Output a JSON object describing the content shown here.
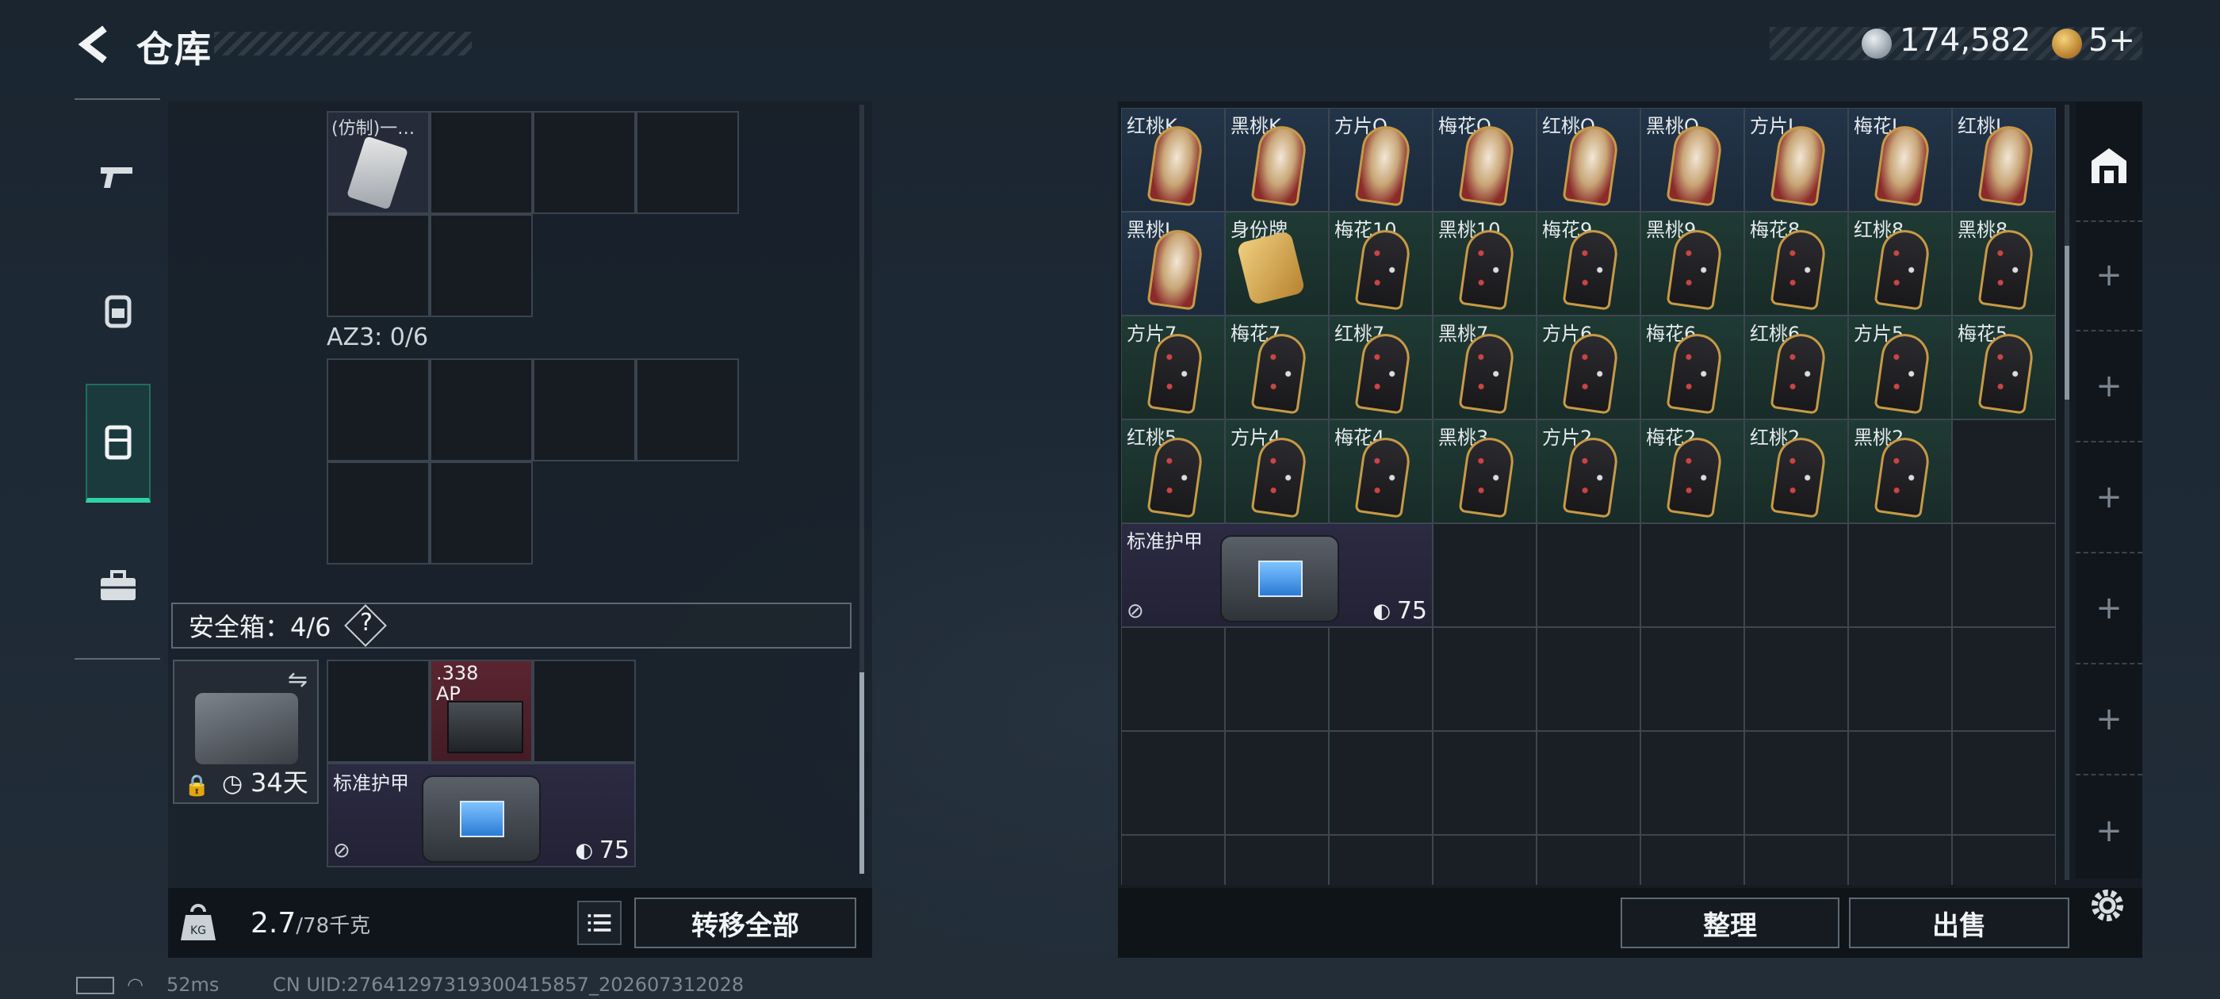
{
  "header": {
    "title": "仓库",
    "money": "174,582",
    "coupons": "5+"
  },
  "nav": {
    "items": [
      "weapon",
      "backpack",
      "vest",
      "case"
    ],
    "active": 2
  },
  "left": {
    "item1_label": "(仿制)一…",
    "az3_label": "AZ3: 0/6",
    "safe_box": {
      "label": "安全箱：4/6",
      "help": "?",
      "days": "34天"
    },
    "ammo_label": ".338\nAP",
    "armor_label": "标准护甲",
    "armor_value": "75",
    "weight": "2.7",
    "weight_max": "/78千克",
    "transfer_all": "转移全部"
  },
  "right": {
    "rows": [
      [
        "红桃K",
        "黑桃K",
        "方片Q",
        "梅花Q",
        "红桃Q",
        "黑桃Q",
        "方片J",
        "梅花J",
        "红桃J"
      ],
      [
        "黑桃J",
        "身份牌",
        "梅花10",
        "黑桃10",
        "梅花9",
        "黑桃9",
        "梅花8",
        "红桃8",
        "黑桃8"
      ],
      [
        "方片7",
        "梅花7",
        "红桃7",
        "黑桃7",
        "方片6",
        "梅花6",
        "红桃6",
        "方片5",
        "梅花5"
      ],
      [
        "红桃5",
        "方片4",
        "梅花4",
        "黑桃3",
        "方片2",
        "梅花2",
        "红桃2",
        "黑桃2",
        ""
      ]
    ],
    "armor_label": "标准护甲",
    "armor_value": "75",
    "sort": "整理",
    "sell": "出售"
  },
  "status": {
    "ping": "52ms",
    "uid": "CN UID:27641297319300415857_202607312028"
  },
  "colors": {
    "accent": "#2fd3a3",
    "gold": "#c79a46"
  }
}
